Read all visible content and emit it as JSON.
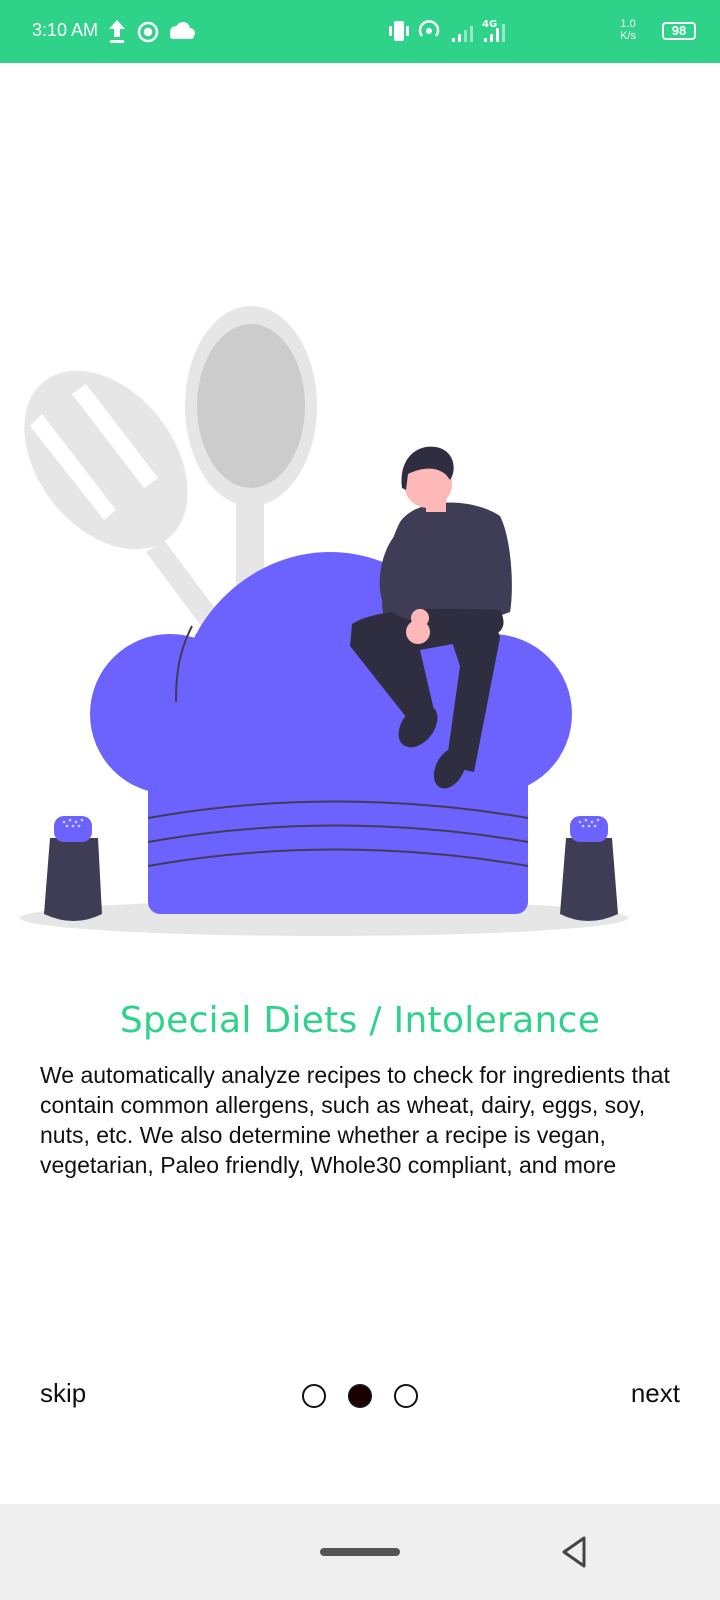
{
  "status_bar": {
    "time": "3:10 AM",
    "network": "4G",
    "speed_value": "1.0",
    "speed_unit": "K/s",
    "battery": "98",
    "icons": [
      "upload-icon",
      "hotspot-icon",
      "cloud-icon",
      "vibrate-icon",
      "wifi-hotspot-icon",
      "signal-icon",
      "signal-4g-icon",
      "battery-icon"
    ]
  },
  "onboarding": {
    "title": "Special Diets / Intolerance",
    "description": "We automatically analyze recipes to check for ingredients that contain common allergens, such as wheat, dairy, eggs, soy, nuts, etc. We also determine whether a recipe is vegan, vegetarian, Paleo friendly, Whole30 compliant, and more",
    "page_indicator": {
      "total": 3,
      "active_index": 1
    },
    "skip_label": "skip",
    "next_label": "next"
  },
  "colors": {
    "accent": "#2ed389",
    "hat": "#6c63ff",
    "dark": "#3f3d56"
  }
}
